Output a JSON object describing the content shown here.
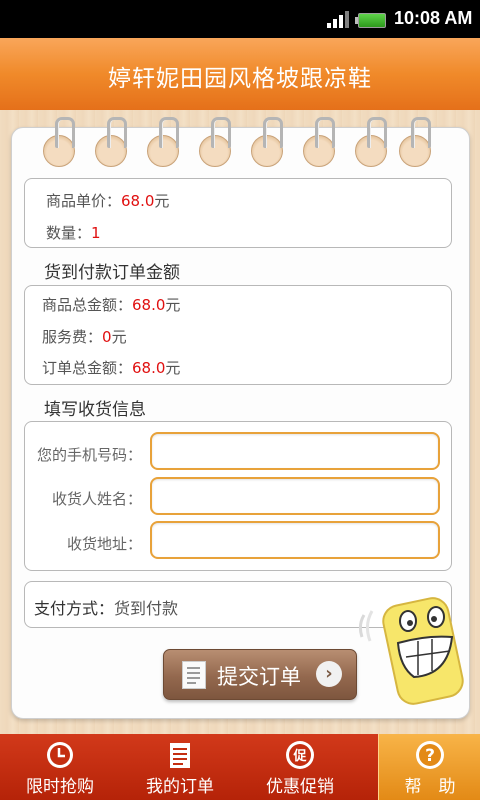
{
  "status_bar": {
    "time": "10:08 AM"
  },
  "header": {
    "title": "婷轩妮田园风格坡跟凉鞋"
  },
  "product": {
    "unit_price_label": "商品单价：",
    "unit_price_value": "68.0",
    "unit_price_unit": "元",
    "quantity_label": "数量：",
    "quantity_value": "1"
  },
  "cod_section": {
    "heading": "货到付款订单金额",
    "goods_total_label": "商品总金额：",
    "goods_total_value": "68.0",
    "goods_total_unit": "元",
    "service_fee_label": "服务费：",
    "service_fee_value": "0",
    "service_fee_unit": "元",
    "order_total_label": "订单总金额：",
    "order_total_value": "68.0",
    "order_total_unit": "元"
  },
  "shipping": {
    "heading": "填写收货信息",
    "phone_label": "您的手机号码：",
    "phone_value": "",
    "name_label": "收货人姓名：",
    "name_value": "",
    "address_label": "收货地址：",
    "address_value": ""
  },
  "payment": {
    "label": "支付方式：",
    "value": "货到付款"
  },
  "submit": {
    "label": "提交订单"
  },
  "tabs": [
    {
      "label": "限时抢购",
      "icon": "clock-icon"
    },
    {
      "label": "我的订单",
      "icon": "order-list-icon"
    },
    {
      "label": "优惠促销",
      "icon": "promo-icon",
      "icon_text": "促"
    },
    {
      "label": "帮　助",
      "icon": "help-icon",
      "icon_text": "?"
    }
  ],
  "colors": {
    "accent": "#f08a2a",
    "price_red": "#e01010",
    "field_border": "#e8a23a",
    "tab_bar": "#c42e10",
    "tab_active": "#f0a030"
  }
}
